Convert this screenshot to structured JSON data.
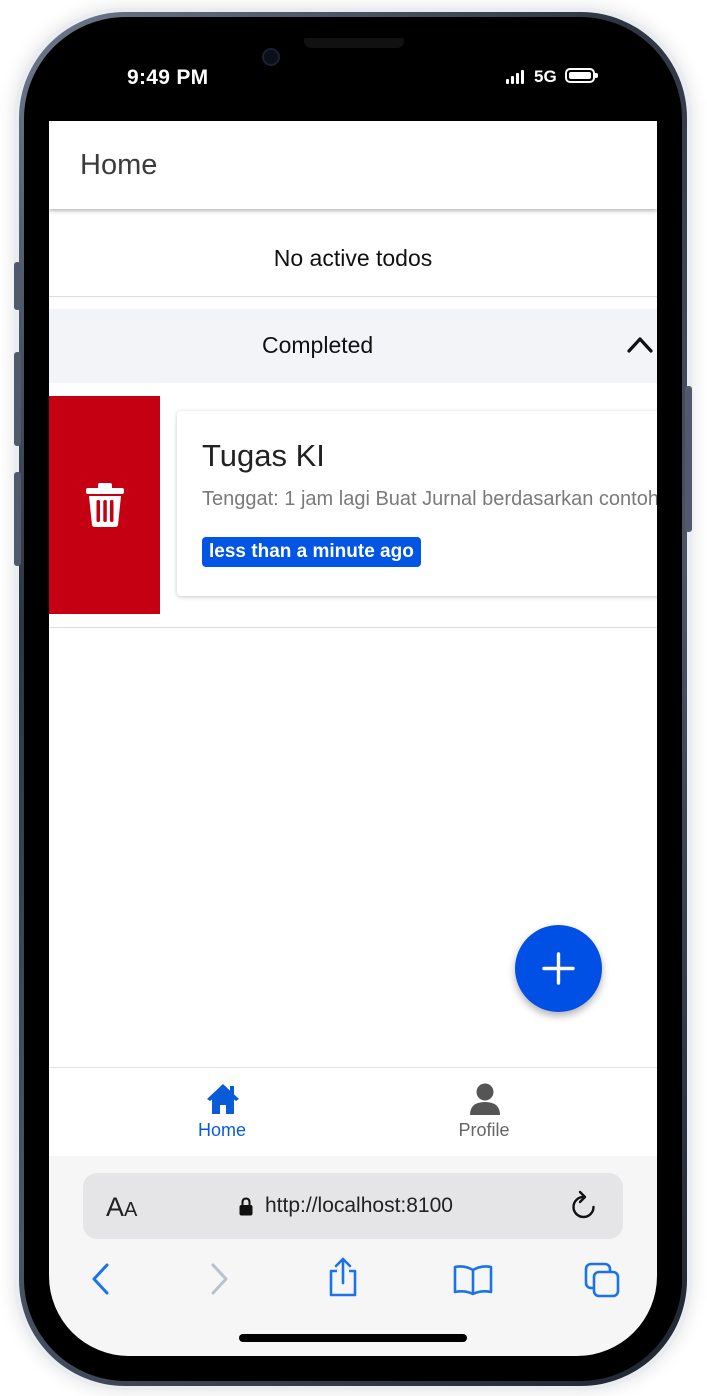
{
  "status_bar": {
    "time": "9:49 PM",
    "network": "5G",
    "icons": [
      "signal-icon",
      "battery-icon"
    ]
  },
  "toolbar": {
    "title": "Home"
  },
  "todos": {
    "empty_message": "No active todos"
  },
  "completed_section": {
    "header": "Completed",
    "expanded": true,
    "items": [
      {
        "title": "Tugas KI",
        "description": "Tenggat: 1 jam lagi Buat Jurnal berdasarkan contoh",
        "badge": "less than a minute ago"
      }
    ]
  },
  "swipe_action": {
    "icon": "trash-icon",
    "color": "#c60013"
  },
  "fab": {
    "icon": "add-icon",
    "color": "#0050e6"
  },
  "tab_bar": {
    "tabs": [
      {
        "label": "Home",
        "icon": "home-icon",
        "selected": true
      },
      {
        "label": "Profile",
        "icon": "person-icon",
        "selected": false
      }
    ]
  },
  "browser": {
    "aa_big": "A",
    "aa_small": "A",
    "url": "http://localhost:8100",
    "toolbar_icons": [
      "back-icon",
      "forward-icon",
      "share-icon",
      "bookmarks-icon",
      "tabs-icon"
    ]
  },
  "colors": {
    "accent": "#0a5bd8",
    "badge": "#0055e5",
    "delete": "#c60013"
  }
}
